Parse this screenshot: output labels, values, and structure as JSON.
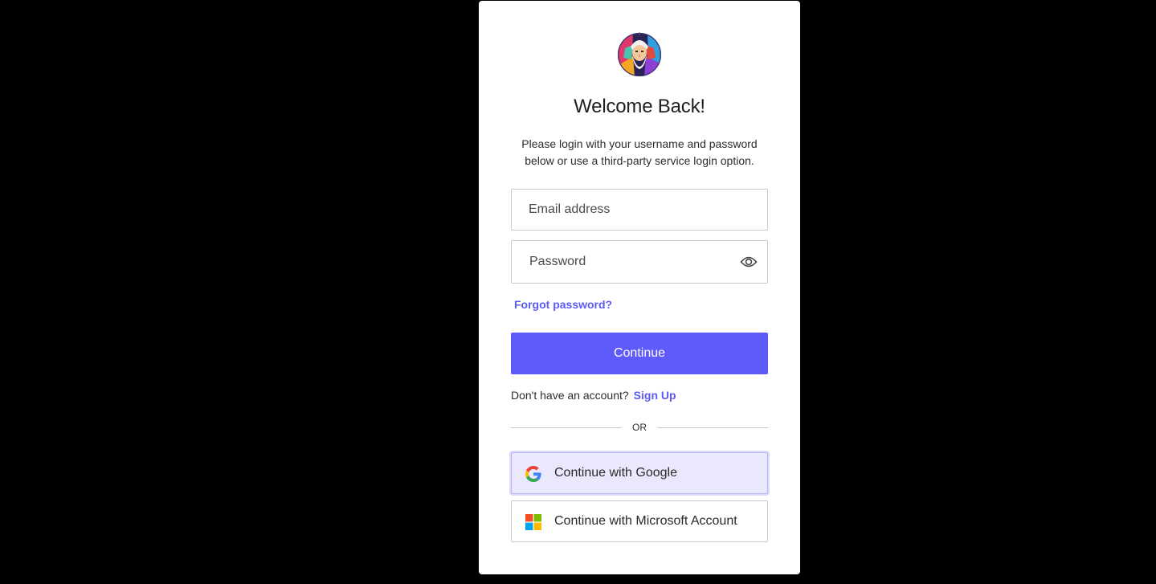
{
  "login": {
    "title": "Welcome Back!",
    "subtitle": "Please login with your username and password below or use a third-party service login option.",
    "email_placeholder": "Email address",
    "password_placeholder": "Password",
    "forgot_password": "Forgot password?",
    "continue_label": "Continue",
    "signup_prompt": "Don't have an account?",
    "signup_link": "Sign Up",
    "divider_text": "OR",
    "google_label": "Continue with Google",
    "microsoft_label": "Continue with Microsoft Account"
  },
  "icons": {
    "logo": "app-logo",
    "password_toggle": "eye-icon",
    "google": "google-icon",
    "microsoft": "microsoft-icon"
  },
  "colors": {
    "accent": "#5f5bfb",
    "link": "#5b5bf5",
    "background": "#000000",
    "card": "#ffffff",
    "google_button_bg": "#e9e8fd"
  }
}
